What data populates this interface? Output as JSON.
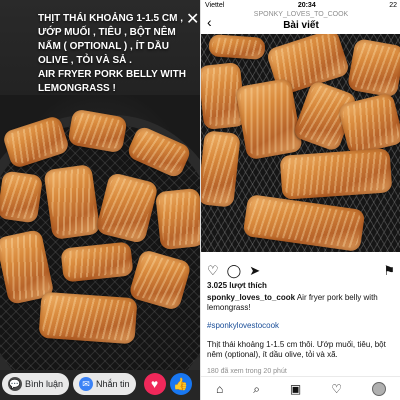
{
  "story": {
    "overlay_text": "THỊT THÁI KHOẢNG 1-1.5 CM ,\nƯỚP MUỐI , TIÊU , BỘT NÊM\nNẤM ( OPTIONAL ) , ÍT DẦU\nOLIVE , TỎI VÀ SẢ .\nAIR FRYER PORK BELLY WITH\nLEMONGRASS !",
    "close_icon": "close-icon",
    "comment_label": "Bình luận",
    "message_label": "Nhắn tin",
    "reactions": [
      "heart-icon",
      "like-icon"
    ],
    "colors": {
      "heart": "#f0285a",
      "like": "#1877f2",
      "messenger": "#3b82f6"
    }
  },
  "status_bar": {
    "carrier": "Viettel",
    "time": "20:34",
    "battery": "22"
  },
  "post": {
    "username_top": "SPONKY_LOVES_TO_COOK",
    "header_title": "Bài viết",
    "likes": "3.025 lượt thích",
    "caption_user": "sponky_loves_to_cook",
    "caption_text": " Air fryer pork belly with lemongrass!",
    "hashtag": "#sponkylovestocook",
    "description": "Thịt thái khoảng 1-1.5 cm thôi. Ướp muối, tiêu, bột nêm (optional), ít dầu olive, tỏi và xã.",
    "timestamp": "180 đã xem trong 20 phút"
  },
  "tabs": [
    "home-icon",
    "search-icon",
    "reels-icon",
    "activity-icon",
    "profile-icon"
  ]
}
